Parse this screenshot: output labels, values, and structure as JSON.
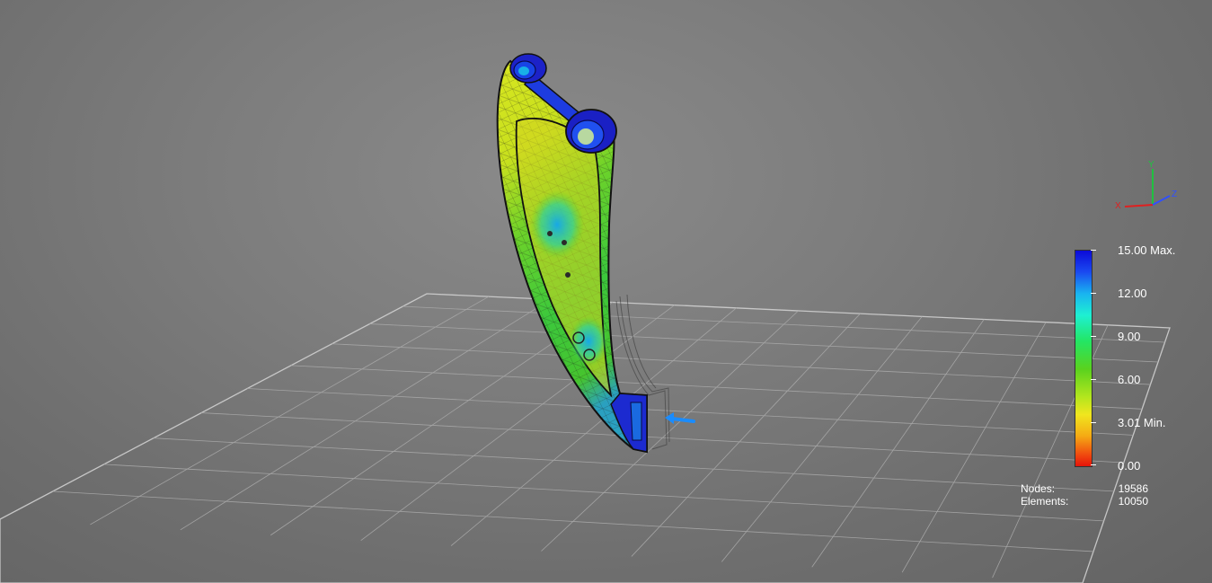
{
  "legend": {
    "labels": [
      {
        "text": "15.00 Max."
      },
      {
        "text": "12.00"
      },
      {
        "text": "9.00"
      },
      {
        "text": "6.00"
      },
      {
        "text": "3.01 Min."
      },
      {
        "text": "0.00"
      }
    ]
  },
  "stats": {
    "nodes_label": "Nodes:",
    "nodes_value": "19586",
    "elements_label": "Elements:",
    "elements_value": "10050"
  },
  "triad": {
    "x_label": "X",
    "y_label": "Y",
    "z_label": "Z",
    "x_color": "#e02020",
    "y_color": "#20c040",
    "z_color": "#3050ff"
  }
}
